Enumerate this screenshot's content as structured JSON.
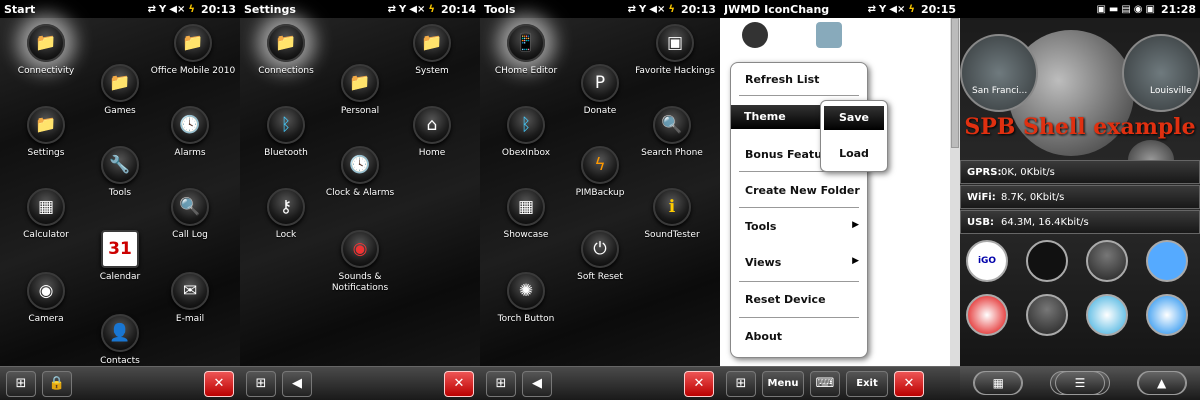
{
  "screens": [
    {
      "title": "Start",
      "time": "20:13",
      "apps": [
        "Connectivity",
        "Games",
        "Office Mobile 2010",
        "Settings",
        "Alarms",
        "Tools",
        "Calculator",
        "Call Log",
        "Calendar",
        "Camera",
        "E-mail",
        "Contacts"
      ]
    },
    {
      "title": "Settings",
      "time": "20:14",
      "apps": [
        "Connections",
        "System",
        "Personal",
        "Home",
        "Bluetooth",
        "Clock & Alarms",
        "Lock",
        "Sounds & Notifications"
      ]
    },
    {
      "title": "Tools",
      "time": "20:13",
      "apps": [
        "CHome Editor",
        "Favorite Hackings",
        "Donate",
        "ObexInbox",
        "Search Phone",
        "PIMBackup",
        "Showcase",
        "SoundTester",
        "Soft Reset",
        "Torch Button"
      ]
    }
  ],
  "iconchanger": {
    "title": "JWMD IconChang",
    "time": "20:15",
    "menu": [
      "Refresh List",
      "Theme",
      "Bonus Feature",
      "Create New Folder",
      "Tools",
      "Views",
      "Reset Device",
      "About"
    ],
    "submenu": [
      "Save",
      "Load"
    ],
    "taskbar": {
      "menu": "Menu",
      "exit": "Exit"
    }
  },
  "spb": {
    "time": "21:28",
    "city_left": "San Franci...",
    "city_right": "Louisville",
    "headline": "SPB Shell example",
    "rows": [
      {
        "label": "GPRS:",
        "value": "0K, 0Kbit/s"
      },
      {
        "label": "WiFi:",
        "value": "8.7K, 0Kbit/s"
      },
      {
        "label": "USB:",
        "value": "64.3M, 16.4Kbit/s"
      }
    ],
    "tile_igo": "iGO"
  }
}
